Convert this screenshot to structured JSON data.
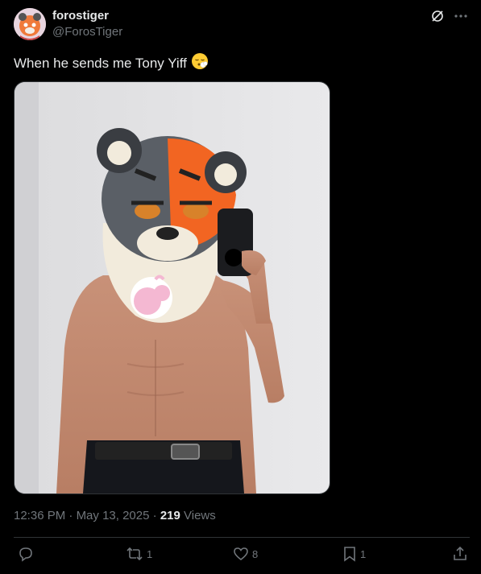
{
  "author": {
    "display_name": "forostiger",
    "handle": "@ForosTiger"
  },
  "post": {
    "text": "When he sends me Tony Yiff",
    "emoji": "😮‍💨"
  },
  "meta": {
    "time": "12:36 PM",
    "date": "May 13, 2025",
    "views_count": "219",
    "views_label": "Views"
  },
  "actions": {
    "reposts": "1",
    "likes": "8",
    "bookmarks": "1"
  },
  "icons": {
    "grok": "grok-icon",
    "more": "more-icon",
    "reply": "reply-icon",
    "repost": "repost-icon",
    "like": "like-icon",
    "bookmark": "bookmark-icon",
    "share": "share-icon"
  }
}
